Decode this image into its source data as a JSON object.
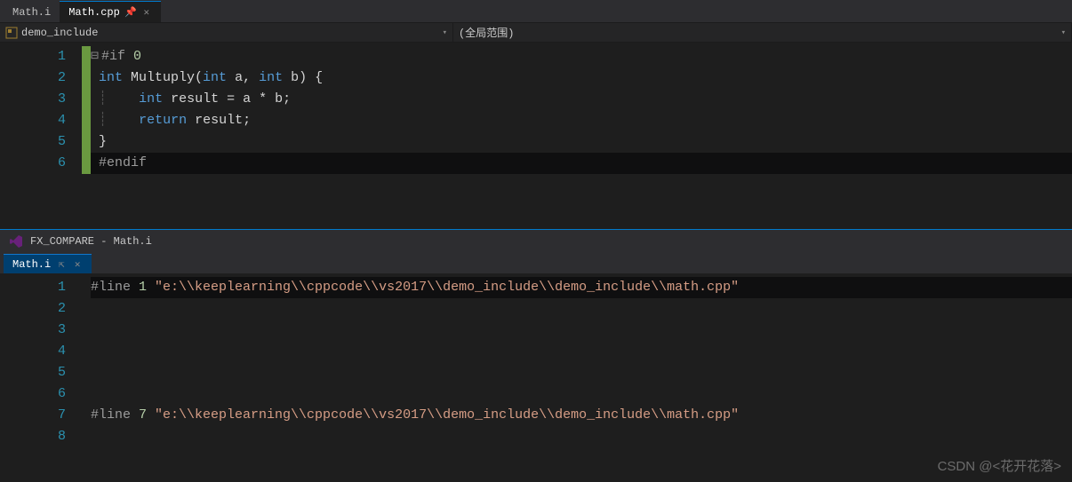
{
  "top_tabs": {
    "inactive": "Math.i",
    "active": "Math.cpp"
  },
  "nav": {
    "scope_icon": "◰",
    "scope_label": "demo_include",
    "member_label": "(全局范围)"
  },
  "editor_top": {
    "lines": [
      "1",
      "2",
      "3",
      "4",
      "5",
      "6"
    ],
    "raw": {
      "l1_pp": "#if ",
      "l1_num": "0",
      "l2_kw1": "int ",
      "l2_id": "Multuply(",
      "l2_kw2": "int ",
      "l2_a": "a, ",
      "l2_kw3": "int ",
      "l2_b": "b) {",
      "l3_indent": "    ",
      "l3_kw": "int ",
      "l3_rest": "result = a * b;",
      "l4_indent": "    ",
      "l4_kw": "return ",
      "l4_rest": "result;",
      "l5": "}",
      "l6": "#endif"
    }
  },
  "pane2": {
    "title": "FX_COMPARE - Math.i",
    "tab": "Math.i"
  },
  "editor_bottom": {
    "lines": [
      "1",
      "2",
      "3",
      "4",
      "5",
      "6",
      "7",
      "8"
    ],
    "raw": {
      "l1_pp": "#line ",
      "l1_num": "1 ",
      "l1_str": "\"e:\\\\keeplearning\\\\cppcode\\\\vs2017\\\\demo_include\\\\demo_include\\\\math.cpp\"",
      "l7_pp": "#line ",
      "l7_num": "7 ",
      "l7_str": "\"e:\\\\keeplearning\\\\cppcode\\\\vs2017\\\\demo_include\\\\demo_include\\\\math.cpp\""
    }
  },
  "watermark": "CSDN @<花开花落>"
}
